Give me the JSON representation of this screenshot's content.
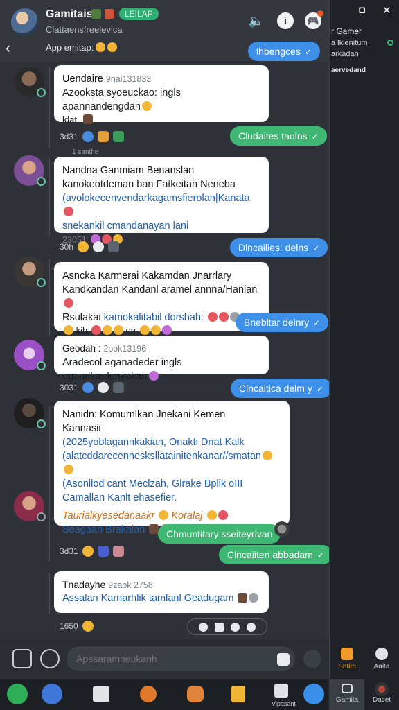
{
  "header": {
    "title": "Gamitais",
    "pill": "LEILAP",
    "subtitle": "Clattaensfreelevica",
    "note": "App emitap:",
    "back_label": "‹",
    "vol_icon": "🔈",
    "info_icon": "i",
    "game_icon": "🎮"
  },
  "messages": [
    {
      "name": "Uendaire",
      "time": "9nai131833",
      "lines": [
        "Azooksta syoeuckao: ingls apannandengdan"
      ],
      "tail": "ldat."
    },
    {
      "name": "Nandna Ganmiam Benanslan",
      "lines": [
        "kanokeotdeman ban Fatkeitan Neneba"
      ],
      "blue": [
        "(avolokecenvendarkagamsfierolan|Kanata",
        "snekankil cmandanayan lani"
      ],
      "time": "23051"
    },
    {
      "name": "Asncka Karmerai Kakamdan Jnarrlary",
      "lines": [
        "Kandkandan Kandanl aramel annna/Hanian"
      ],
      "mixed_a": "Rsulakai",
      "mixed_b": "kamokalitabil dorshah:",
      "tail": "kih",
      "tail2": "on"
    },
    {
      "name": "Geodah :",
      "time": "2ook13196",
      "lines": [
        "Aradecol aganadeder ingls ogandlandenyakan"
      ]
    },
    {
      "name": "Nanidn: Komurnlkan Jnekani Kemen",
      "lines": [
        "Kannasii"
      ],
      "blue": [
        "(2025yoblagannkakian, Onakti Dnat Kalk",
        "(alatcddarecennesksllatainitenkanar//smatan",
        "(Asonllod cant Meclzah, Glrake Bplik oIII",
        "Camallan Kanlt ehasefier."
      ],
      "orange": "Taurialkyesedanaakr",
      "orange2": "Koralaj",
      "blue2": "Seagaan Brakalan"
    },
    {
      "name": "Tnadayhe",
      "time": "9zaok 2758",
      "lines": [
        "Assalan Karnarhlik tamlanl Geadugam"
      ]
    }
  ],
  "pills": [
    {
      "text": "lhbengces",
      "color": "blue"
    },
    {
      "text": "Cludaites taolns",
      "color": "green"
    },
    {
      "text": "Dlncailies: delns",
      "color": "blue"
    },
    {
      "text": "Bnebltar delnry",
      "color": "blue"
    },
    {
      "text": "Clncaitica delm y",
      "color": "blue"
    },
    {
      "text": "Chmuntitary sseiteyrivan",
      "color": "green"
    },
    {
      "text": "Clncaiiten abbadam",
      "color": "green"
    }
  ],
  "reactions": [
    {
      "time": "3d31"
    },
    {
      "time": "30h"
    },
    {
      "time": "3031"
    },
    {
      "time": "3d31"
    },
    {
      "time": "1650"
    }
  ],
  "separators": [
    "1 santhe"
  ],
  "composer": {
    "placeholder": "Apssaramneukanh"
  },
  "nav": [
    {
      "label": ""
    },
    {
      "label": ""
    },
    {
      "label": ""
    },
    {
      "label": ""
    },
    {
      "label": ""
    },
    {
      "label": ""
    },
    {
      "label": "Vipasant"
    },
    {
      "label": ""
    }
  ],
  "side": {
    "title": "r Gamer",
    "line1": "a lklenitum",
    "line2": "arkadan",
    "line3": "aervedand",
    "tab1": "Sntim",
    "tab2": "Aaita",
    "bottom1": "Gamita",
    "bottom2": "Dacet"
  }
}
